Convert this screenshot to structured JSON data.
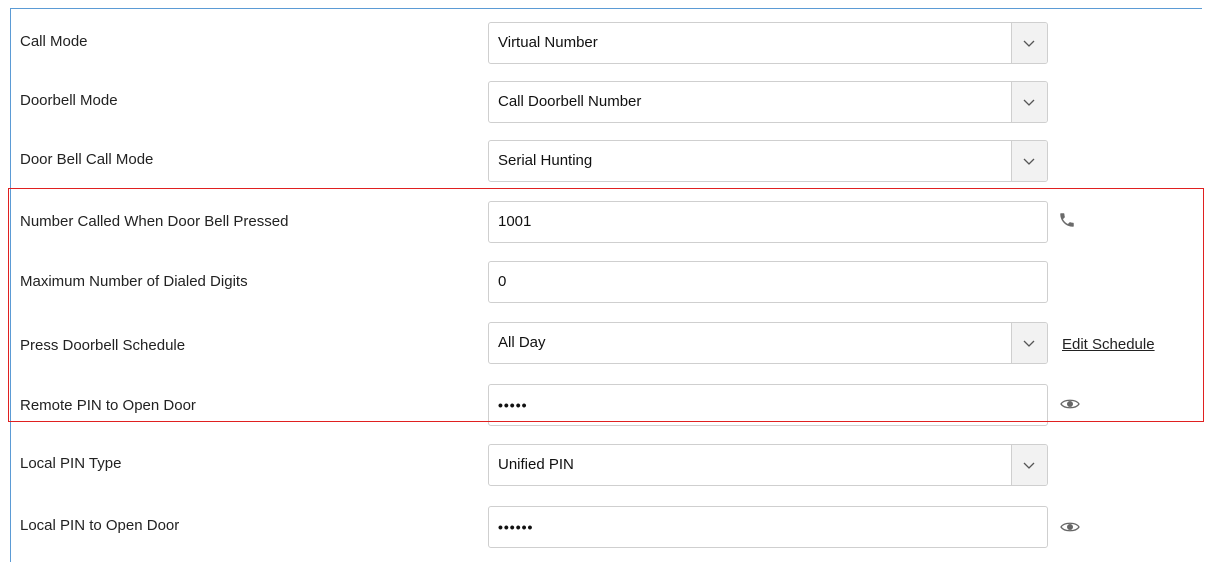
{
  "rows": [
    {
      "label": "Call Mode",
      "value": "Virtual Number"
    },
    {
      "label": "Doorbell Mode",
      "value": "Call Doorbell Number"
    },
    {
      "label": "Door Bell Call Mode",
      "value": "Serial Hunting"
    },
    {
      "label": "Number Called When Door Bell Pressed",
      "value": "1001"
    },
    {
      "label": "Maximum Number of Dialed Digits",
      "value": "0"
    },
    {
      "label": "Press Doorbell Schedule",
      "value": "All Day",
      "link": "Edit Schedule"
    },
    {
      "label": "Remote PIN to Open Door",
      "value": "•••••"
    },
    {
      "label": "Local PIN Type",
      "value": "Unified PIN"
    },
    {
      "label": "Local PIN to Open Door",
      "value": "••••••"
    }
  ],
  "icons": {
    "phone": "phone-icon",
    "eye": "eye-icon",
    "caret": "chevron-down-icon"
  },
  "colors": {
    "highlight_border": "#e02020",
    "frame_border": "#5b9bd5",
    "field_border": "#cfcfcf"
  }
}
